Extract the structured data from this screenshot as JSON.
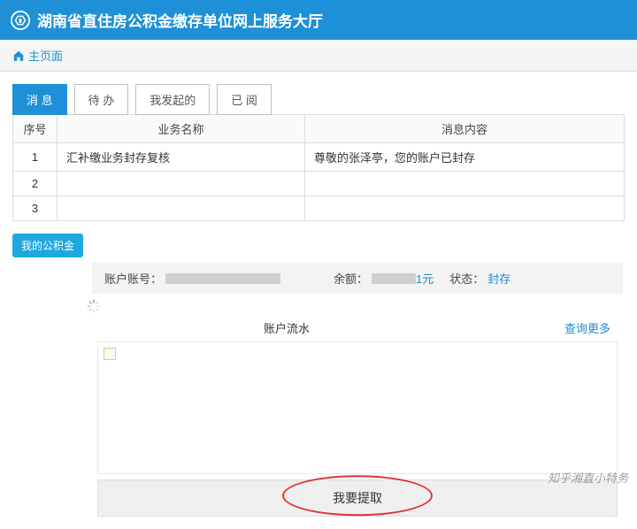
{
  "header": {
    "title": "湖南省直住房公积金缴存单位网上服务大厅"
  },
  "topnav": {
    "home": "主页面"
  },
  "tabs": [
    {
      "label": "消 息",
      "active": true
    },
    {
      "label": "待 办",
      "active": false
    },
    {
      "label": "我发起的",
      "active": false
    },
    {
      "label": "已 阅",
      "active": false
    }
  ],
  "msgTable": {
    "headers": {
      "idx": "序号",
      "name": "业务名称",
      "content": "消息内容"
    },
    "rows": [
      {
        "idx": "1",
        "name": "汇补缴业务封存复核",
        "content": "尊敬的张泽亭，您的账户已封存"
      },
      {
        "idx": "2",
        "name": "",
        "content": ""
      },
      {
        "idx": "3",
        "name": "",
        "content": ""
      }
    ]
  },
  "badge": "我的公积金",
  "account": {
    "acctLabel": "账户账号：",
    "balanceLabel": "余额：",
    "balanceSuffix": "1元",
    "statusLabel": "状态：",
    "statusValue": "封存"
  },
  "flow": {
    "title": "账户流水",
    "more": "查询更多"
  },
  "bottom": {
    "withdraw": "我要提取"
  },
  "watermark": "知乎湘直小特务"
}
